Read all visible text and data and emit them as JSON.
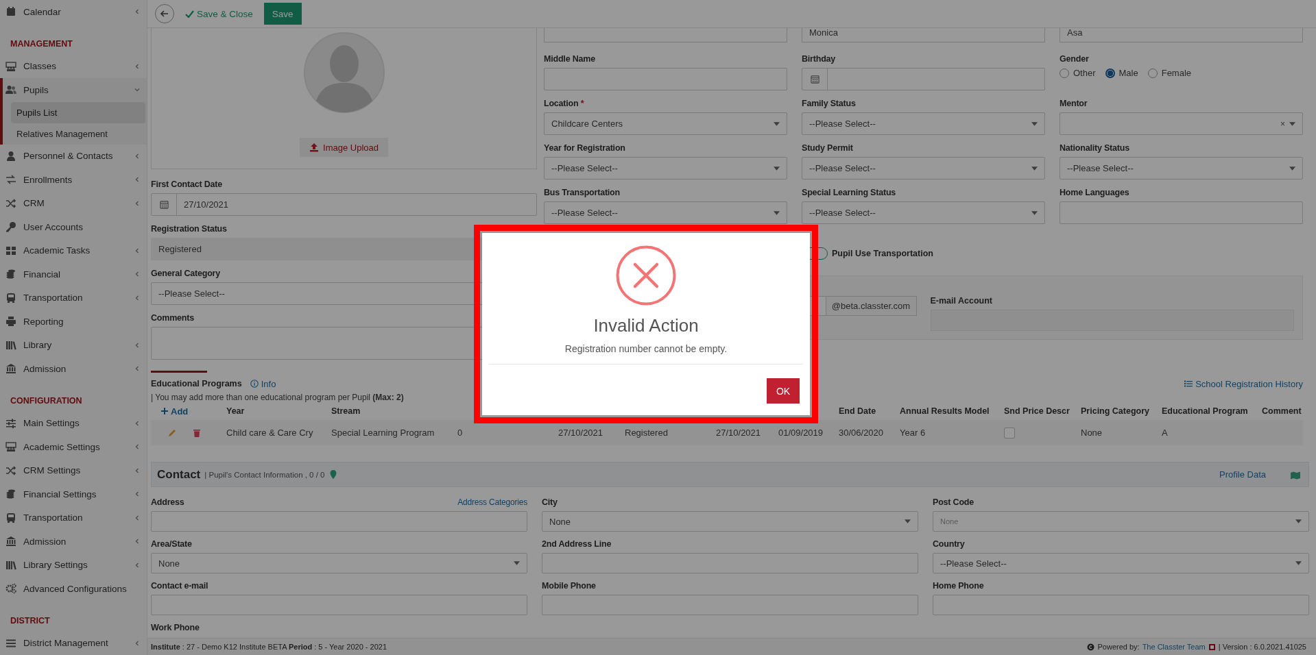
{
  "toolbar": {
    "save_close": "Save & Close",
    "save": "Save"
  },
  "sidebar": {
    "items": [
      {
        "kind": "item",
        "label": "Calendar",
        "expanded": false
      },
      {
        "kind": "section",
        "label": "MANAGEMENT"
      },
      {
        "kind": "item",
        "label": "Classes",
        "expanded": false
      },
      {
        "kind": "item",
        "label": "Pupils",
        "expanded": true,
        "children": [
          {
            "label": "Pupils List",
            "selected": true
          },
          {
            "label": "Relatives Management",
            "selected": false
          }
        ]
      },
      {
        "kind": "item",
        "label": "Personnel & Contacts",
        "expanded": false
      },
      {
        "kind": "item",
        "label": "Enrollments",
        "expanded": false
      },
      {
        "kind": "item",
        "label": "CRM",
        "expanded": false
      },
      {
        "kind": "item",
        "label": "User Accounts"
      },
      {
        "kind": "item",
        "label": "Academic Tasks",
        "expanded": false
      },
      {
        "kind": "item",
        "label": "Financial",
        "expanded": false
      },
      {
        "kind": "item",
        "label": "Transportation",
        "expanded": false
      },
      {
        "kind": "item",
        "label": "Reporting"
      },
      {
        "kind": "item",
        "label": "Library",
        "expanded": false
      },
      {
        "kind": "item",
        "label": "Admission",
        "expanded": false
      },
      {
        "kind": "section",
        "label": "CONFIGURATION"
      },
      {
        "kind": "item",
        "label": "Main Settings",
        "expanded": false
      },
      {
        "kind": "item",
        "label": "Academic Settings",
        "expanded": false
      },
      {
        "kind": "item",
        "label": "CRM Settings",
        "expanded": false
      },
      {
        "kind": "item",
        "label": "Financial Settings",
        "expanded": false
      },
      {
        "kind": "item",
        "label": "Transportation",
        "expanded": false
      },
      {
        "kind": "item",
        "label": "Admission",
        "expanded": false
      },
      {
        "kind": "item",
        "label": "Library Settings",
        "expanded": false
      },
      {
        "kind": "item",
        "label": "Advanced Configurations"
      },
      {
        "kind": "section",
        "label": "DISTRICT"
      },
      {
        "kind": "item",
        "label": "District Management",
        "expanded": false
      }
    ]
  },
  "photo": {
    "upload_button": "Image Upload"
  },
  "left_fields": [
    {
      "label": "First Contact Date",
      "kind": "date",
      "value": "27/10/2021"
    },
    {
      "label": "Registration Status",
      "kind": "readonly",
      "value": "Registered"
    },
    {
      "label": "General Category",
      "kind": "input",
      "value": "--Please Select--"
    },
    {
      "label": "Comments",
      "kind": "textarea"
    }
  ],
  "top_row": [
    {
      "kind": "input"
    },
    {
      "kind": "input",
      "value": "Monica"
    },
    {
      "kind": "input",
      "value": "Asa"
    }
  ],
  "form_columns": [
    {
      "fields": [
        {
          "label": "Middle Name",
          "kind": "input"
        },
        {
          "label": "Location",
          "kind": "select",
          "required_mark": "*",
          "value": "Childcare Centers"
        },
        {
          "label": "Year for Registration",
          "kind": "select",
          "value": "--Please Select--"
        },
        {
          "label": "Bus Transportation",
          "kind": "select",
          "value": "--Please Select--"
        }
      ]
    },
    {
      "fields": [
        {
          "label": "Birthday",
          "kind": "date"
        },
        {
          "label": "Family Status",
          "kind": "select",
          "value": "--Please Select--"
        },
        {
          "label": "Study Permit",
          "kind": "select",
          "value": "--Please Select--"
        },
        {
          "label": "Special Learning Status",
          "kind": "select",
          "value": "--Please Select--"
        },
        {
          "label": "Pupil Use Transportation",
          "kind": "toggle",
          "on": false
        }
      ]
    },
    {
      "fields": [
        {
          "label": "Gender",
          "kind": "radio",
          "options": [
            {
              "label": "Other",
              "selected": false
            },
            {
              "label": "Male",
              "selected": true
            },
            {
              "label": "Female",
              "selected": false
            }
          ]
        },
        {
          "label": "Mentor",
          "kind": "select",
          "clear_icon": "×"
        },
        {
          "label": "Nationality Status",
          "kind": "select",
          "value": "--Please Select--"
        },
        {
          "label": "Home Languages",
          "kind": "input"
        }
      ]
    }
  ],
  "account_panel": {
    "domain": "@beta.classter.com",
    "email_label": "E-mail Account"
  },
  "education": {
    "title": "Educational Programs",
    "info_link": "Info",
    "history_link": "School Registration History",
    "note": "| You may add more than one educational program per Pupil **(Max: 2)**",
    "add": "Add",
    "columns_before_dialog": [
      "Year",
      "Stream"
    ],
    "columns_after_dialog": [
      "End Date",
      "Annual Results Model",
      "Snd Price Descr",
      "Pricing Category",
      "Educational Program",
      "Comment"
    ],
    "rows": [
      {
        "cells": [
          "Child care & Care Cry",
          "Special Learning Program",
          "0",
          "27/10/2021",
          "Registered",
          "27/10/2021",
          "01/09/2019",
          "30/06/2020",
          "Year 6"
        ],
        "snd_price_checked": false,
        "cells_after": [
          "None",
          "A"
        ]
      }
    ]
  },
  "contact": {
    "title": "Contact",
    "subtitle": "| Pupil's Contact Information , 0 / 0",
    "profile_link": "Profile Data",
    "fields": [
      {
        "label": "Address",
        "kind": "input",
        "link": "Address Categories"
      },
      {
        "label": "City",
        "kind": "select",
        "value": "None"
      },
      {
        "label": "Post Code",
        "kind": "select",
        "placeholder": "None"
      },
      {
        "label": "Area/State",
        "kind": "select",
        "value": "None"
      },
      {
        "label": "2nd Address Line",
        "kind": "input"
      },
      {
        "label": "Country",
        "kind": "select",
        "value": "--Please Select--"
      },
      {
        "label": "Contact e-mail",
        "kind": "input"
      },
      {
        "label": "Mobile Phone",
        "kind": "input"
      },
      {
        "label": "Home Phone",
        "kind": "input"
      },
      {
        "label": "Work Phone",
        "kind": "label_only"
      }
    ]
  },
  "footer": {
    "left": "**Institute** : 27 - Demo K12 Institute BETA **Period** : 5 - Year 2020 - 2021",
    "powered_label": "Powered by:",
    "powered_link": "The Classter Team",
    "version": "| Version : 6.0.2021.41025"
  },
  "dialog": {
    "title": "Invalid Action",
    "message": "Registration number cannot be empty.",
    "ok": "OK"
  }
}
